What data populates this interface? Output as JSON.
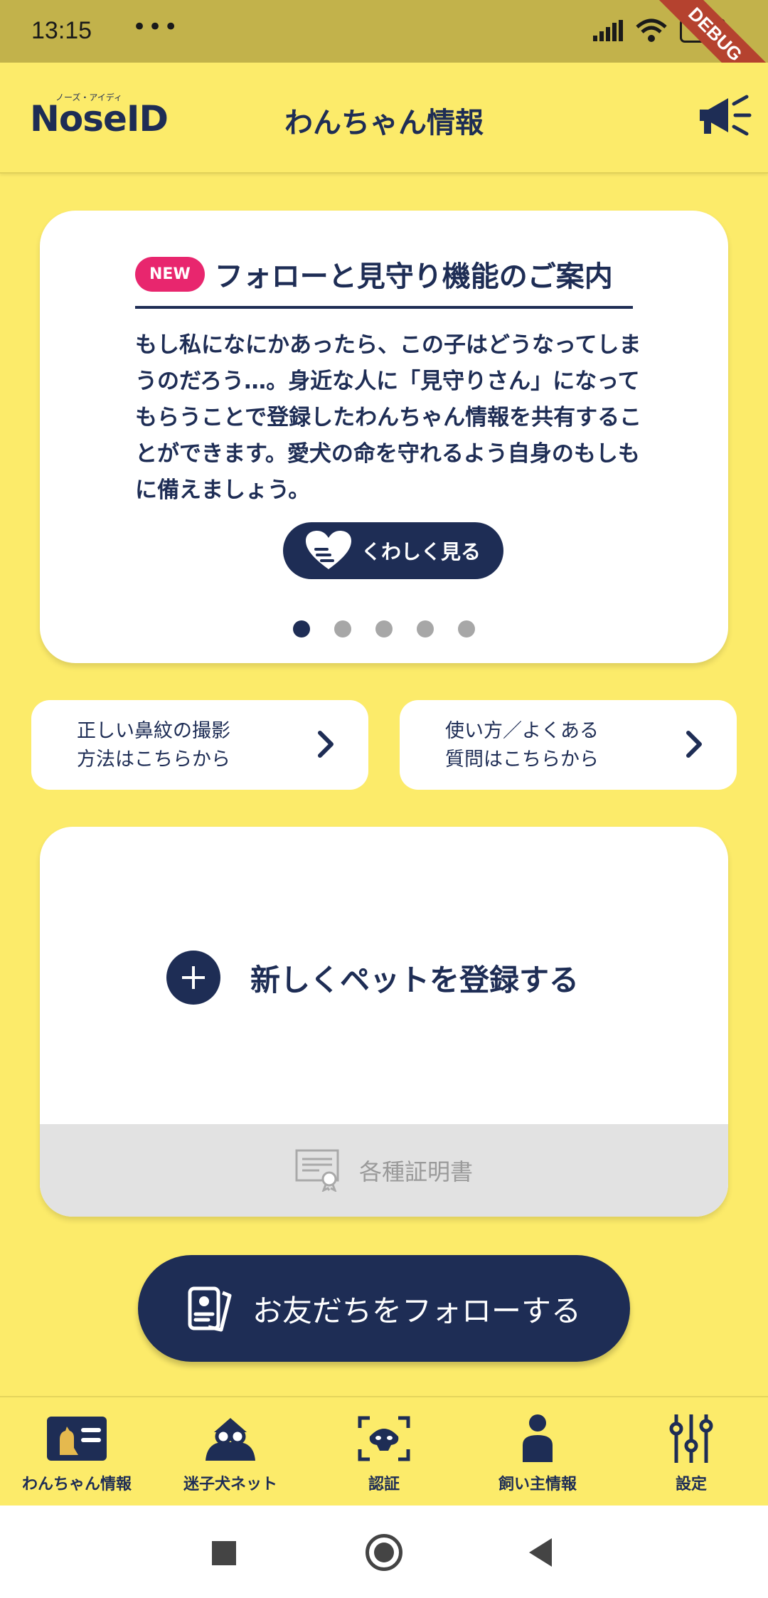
{
  "status_bar": {
    "time": "13:15",
    "more": "•••",
    "battery": "39",
    "ribbon": "DEBUG"
  },
  "app_bar": {
    "logo_ruby": "ノーズ・アイディ",
    "logo_text": "NoseID",
    "title": "わんちゃん情報"
  },
  "promo": {
    "badge": "NEW",
    "title": "フォローと見守り機能のご案内",
    "body": "もし私になにかあったら、この子はどうなってしまうのだろう…。身近な人に「見守りさん」になってもらうことで登録したわんちゃん情報を共有することができます。愛犬の命を守れるよう自身のもしもに備えましょう。",
    "button_label": "くわしく見る",
    "page_count": 5,
    "active_page": 1
  },
  "links": {
    "photo_guide_line1": "正しい鼻紋の撮影",
    "photo_guide_line2": "方法はこちらから",
    "faq_line1": "使い方／よくある",
    "faq_line2": "質問はこちらから"
  },
  "register": {
    "label": "新しくペットを登録する",
    "certificates": "各種証明書"
  },
  "follow_button": "お友だちをフォローする",
  "bottom_nav": {
    "items": [
      {
        "label": "わんちゃん情報",
        "icon": "dog-card-icon"
      },
      {
        "label": "迷子犬ネット",
        "icon": "searcher-icon"
      },
      {
        "label": "認証",
        "icon": "nose-scan-icon"
      },
      {
        "label": "飼い主情報",
        "icon": "person-icon"
      },
      {
        "label": "設定",
        "icon": "sliders-icon"
      }
    ]
  },
  "colors": {
    "brand_yellow": "#FCEB6A",
    "navy": "#1E2D55",
    "new_badge": "#E8266E"
  }
}
